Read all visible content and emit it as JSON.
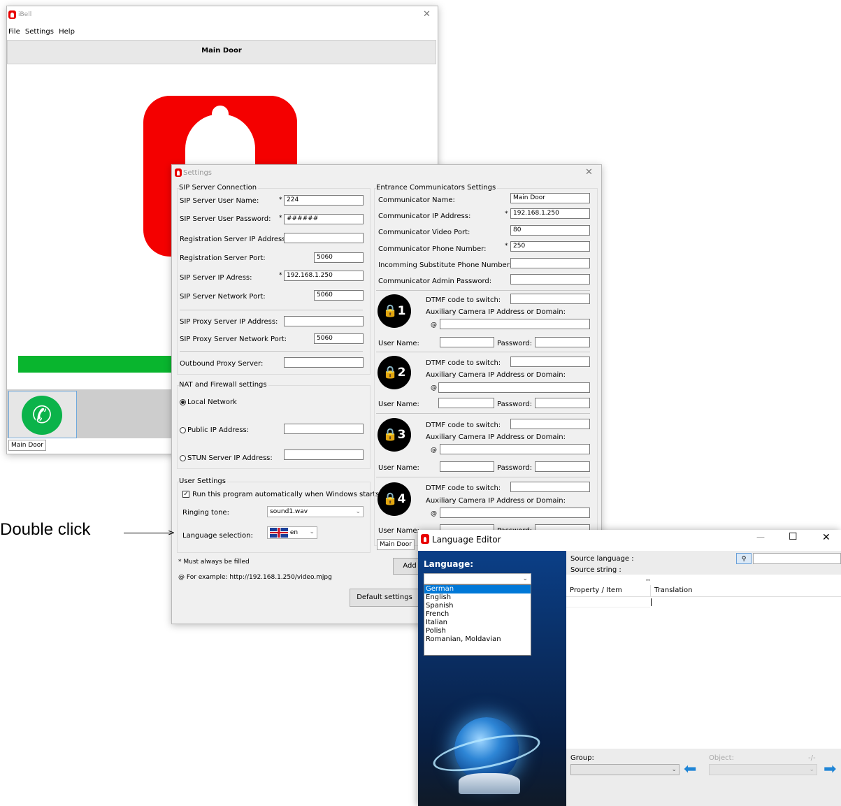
{
  "annotation": {
    "text": "Double click"
  },
  "ibell": {
    "title": "iBell",
    "menu": [
      "File",
      "Settings",
      "Help"
    ],
    "door_tab": "Main Door",
    "bottom_tab": "Main Door",
    "progress_fraction": 1.0,
    "colors": {
      "logo": "#f40000",
      "progress": "#09b52e",
      "call": "#0bb34a"
    }
  },
  "settings": {
    "title": "Settings",
    "sip": {
      "group": "SIP Server Connection",
      "user_name_label": "SIP Server User Name:",
      "user_name": "224",
      "password_label": "SIP Server User Password:",
      "password": "######",
      "reg_ip_label": "Registration Server IP Address:",
      "reg_ip": "",
      "reg_port_label": "Registration Server Port:",
      "reg_port": "5060",
      "server_ip_label": "SIP Server IP Adress:",
      "server_ip": "192.168.1.250",
      "net_port_label": "SIP Server Network Port:",
      "net_port": "5060",
      "proxy_ip_label": "SIP Proxy Server IP Address:",
      "proxy_ip": "",
      "proxy_port_label": "SIP Proxy Server Network Port:",
      "proxy_port": "5060",
      "outbound_label": "Outbound Proxy Server:",
      "outbound": ""
    },
    "nat": {
      "group": "NAT and Firewall settings",
      "local": "Local Network",
      "public": "Public IP Address:",
      "stun": "STUN Server IP Address:",
      "selected": "Local Network"
    },
    "user": {
      "group": "User Settings",
      "autorun": "Run this program automatically when Windows starts",
      "autorun_checked": true,
      "ringing_label": "Ringing tone:",
      "ringing": "sound1.wav",
      "language_label": "Language selection:",
      "language": "en"
    },
    "notes": {
      "must": "* Must always be filled",
      "example": "@  For example:  http://192.168.1.250/video.mjpg"
    },
    "default_button": "Default settings",
    "add_button": "Add",
    "star": "*",
    "at": "@",
    "entrance": {
      "group": "Entrance Communicators Settings",
      "name_label": "Communicator Name:",
      "name": "Main Door",
      "ip_label": "Communicator IP Address:",
      "ip": "192.168.1.250",
      "video_label": "Communicator Video Port:",
      "video": "80",
      "phone_label": "Communicator Phone Number:",
      "phone": "250",
      "subst_label": "Incomming Substitute Phone Number:",
      "subst": "",
      "admin_label": "Communicator Admin Password:",
      "admin": "",
      "dtmf_label": "DTMF code to switch:",
      "camera_label": "Auxiliary Camera IP Address or Domain:",
      "user_label": "User Name:",
      "pass_label": "Password:",
      "locks": [
        "1",
        "2",
        "3",
        "4"
      ],
      "tab": "Main Door"
    }
  },
  "lang_editor": {
    "title": "Language Editor",
    "language_label": "Language:",
    "options": [
      "German",
      "English",
      "Spanish",
      "French",
      "Italian",
      "Polish",
      "Romanian, Moldavian"
    ],
    "selected": "German",
    "source_language": "Source language :",
    "source_string": "Source string :",
    "col_property": "Property / Item",
    "col_translation": "Translation",
    "group_label": "Group:",
    "object_label": "Object:",
    "counter": "-/-"
  }
}
